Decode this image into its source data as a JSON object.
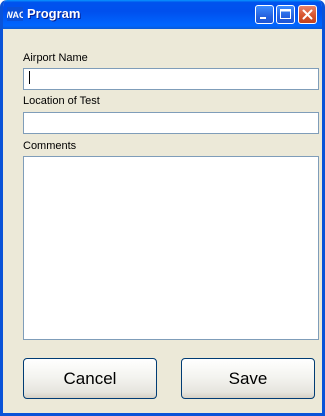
{
  "window": {
    "title": "Program",
    "icon": "app-icon",
    "controls": [
      "minimize-icon",
      "maximize-icon",
      "close-icon"
    ],
    "colors": {
      "titlebar": "#0055ea",
      "frame": "#0a53d8",
      "body": "#ece9d8",
      "close_button": "#d8552f"
    }
  },
  "form": {
    "airport_name": {
      "label": "Airport Name",
      "value": ""
    },
    "location_of_test": {
      "label": "Location of Test",
      "value": ""
    },
    "comments": {
      "label": "Comments",
      "value": ""
    }
  },
  "buttons": {
    "cancel_label": "Cancel",
    "save_label": "Save"
  }
}
